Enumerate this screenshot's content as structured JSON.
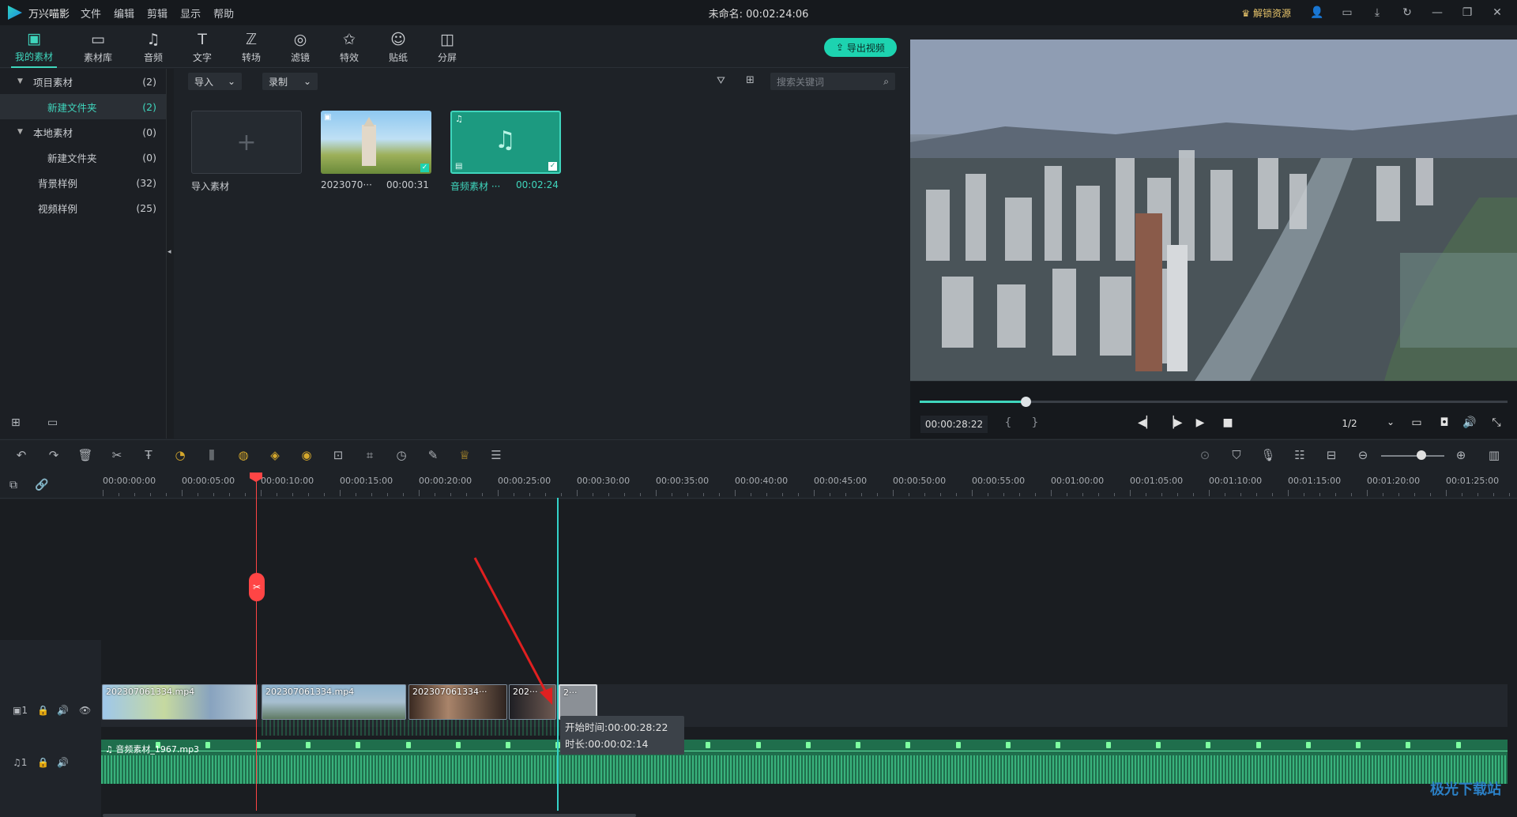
{
  "app": {
    "name": "万兴喵影",
    "menus": [
      "文件",
      "编辑",
      "剪辑",
      "显示",
      "帮助"
    ],
    "document_title": "未命名: 00:02:24:06",
    "unlock_label": "解锁资源"
  },
  "toolbar": {
    "tabs": [
      {
        "label": "我的素材",
        "icon": "folder-media-icon",
        "active": true
      },
      {
        "label": "素材库",
        "icon": "folder-icon"
      },
      {
        "label": "音频",
        "icon": "music-note-icon"
      },
      {
        "label": "文字",
        "icon": "text-icon"
      },
      {
        "label": "转场",
        "icon": "transition-icon"
      },
      {
        "label": "滤镜",
        "icon": "filter-icon"
      },
      {
        "label": "特效",
        "icon": "effects-icon"
      },
      {
        "label": "贴纸",
        "icon": "sticker-icon"
      },
      {
        "label": "分屏",
        "icon": "split-screen-icon"
      }
    ],
    "export_label": "导出视频"
  },
  "sidebar": {
    "items": [
      {
        "label": "项目素材",
        "count": "(2)",
        "expanded": true
      },
      {
        "label": "新建文件夹",
        "count": "(2)",
        "selected": true
      },
      {
        "label": "本地素材",
        "count": "(0)",
        "expanded": true
      },
      {
        "label": "新建文件夹",
        "count": "(0)"
      },
      {
        "label": "背景样例",
        "count": "(32)"
      },
      {
        "label": "视频样例",
        "count": "(25)"
      }
    ]
  },
  "browser": {
    "import_label": "导入",
    "record_label": "录制",
    "search_placeholder": "搜索关键词",
    "import_tile_label": "导入素材",
    "items": [
      {
        "name": "2023070···",
        "duration": "00:00:31",
        "kind": "video"
      },
      {
        "name": "音频素材 ···",
        "duration": "00:02:24",
        "kind": "audio",
        "selected": true
      }
    ]
  },
  "preview": {
    "timecode": "00:00:28:22",
    "progress": 0.18,
    "quality": "1/2"
  },
  "timeline": {
    "ruler": [
      "00:00:00:00",
      "00:00:05:00",
      "00:00:10:00",
      "00:00:15:00",
      "00:00:20:00",
      "00:00:25:00",
      "00:00:30:00",
      "00:00:35:00",
      "00:00:40:00",
      "00:00:45:00",
      "00:00:50:00",
      "00:00:55:00",
      "00:01:00:00",
      "00:01:05:00",
      "00:01:10:00",
      "00:01:15:00",
      "00:01:20:00",
      "00:01:25:00"
    ],
    "video_clips": [
      "202307061334.mp4",
      "202307061334.mp4",
      "202307061334···",
      "202···",
      "2···"
    ],
    "audio_clip": "音频素材_1967.mp3",
    "video_track_label": "1",
    "audio_track_label": "1",
    "tooltip": {
      "start": "开始时间:00:00:28:22",
      "duration": "时长:00:00:02:14"
    }
  },
  "colors": {
    "accent": "#3fd6bd",
    "playhead": "#ff4545",
    "audio": "#1f6e4c"
  }
}
